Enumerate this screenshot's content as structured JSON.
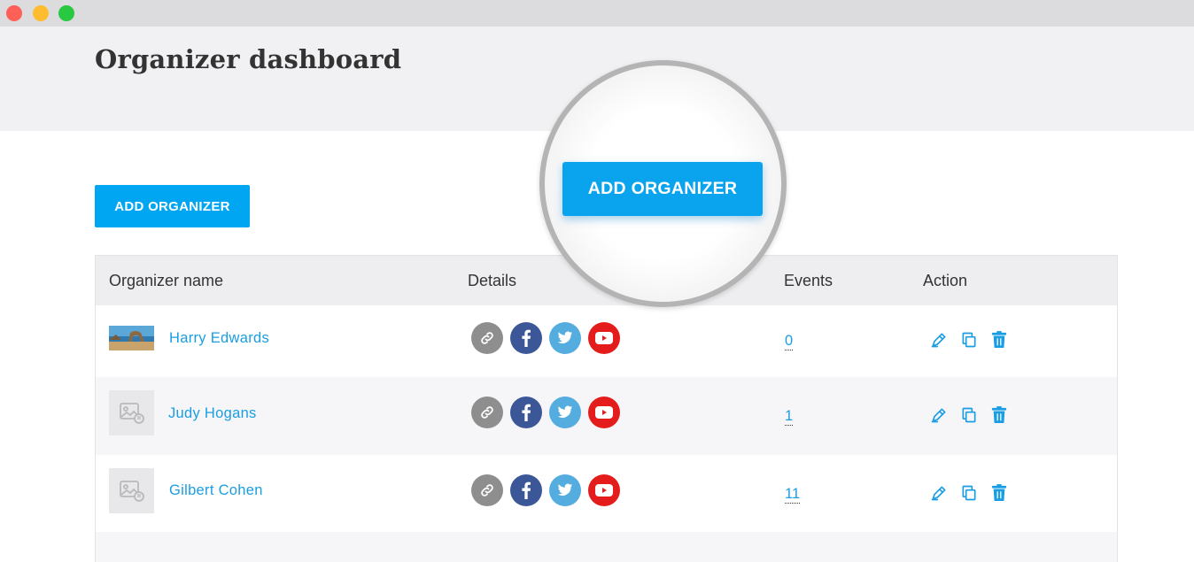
{
  "window": {
    "controls": [
      "close",
      "minimize",
      "maximize"
    ]
  },
  "header": {
    "title": "Organizer dashboard"
  },
  "toolbar": {
    "add_label": "ADD ORGANIZER"
  },
  "magnified": {
    "add_label": "ADD ORGANIZER"
  },
  "table": {
    "columns": [
      "Organizer name",
      "Details",
      "Events",
      "Action"
    ],
    "rows": [
      {
        "name": "Harry Edwards",
        "events": "0",
        "thumb": "photo"
      },
      {
        "name": "Judy Hogans",
        "events": "1",
        "thumb": "placeholder"
      },
      {
        "name": "Gilbert Cohen",
        "events": "11",
        "thumb": "placeholder"
      }
    ]
  },
  "icons": {
    "details": [
      "link-icon",
      "facebook-icon",
      "twitter-icon",
      "youtube-icon"
    ],
    "actions": [
      "edit-icon",
      "duplicate-icon",
      "delete-icon"
    ]
  },
  "colors": {
    "accent": "#00a6f2",
    "link": "#1a9de3",
    "facebook": "#3b5798",
    "twitter": "#55acde",
    "youtube": "#e41c1c",
    "link_icon_bg": "#8e8e8e"
  }
}
